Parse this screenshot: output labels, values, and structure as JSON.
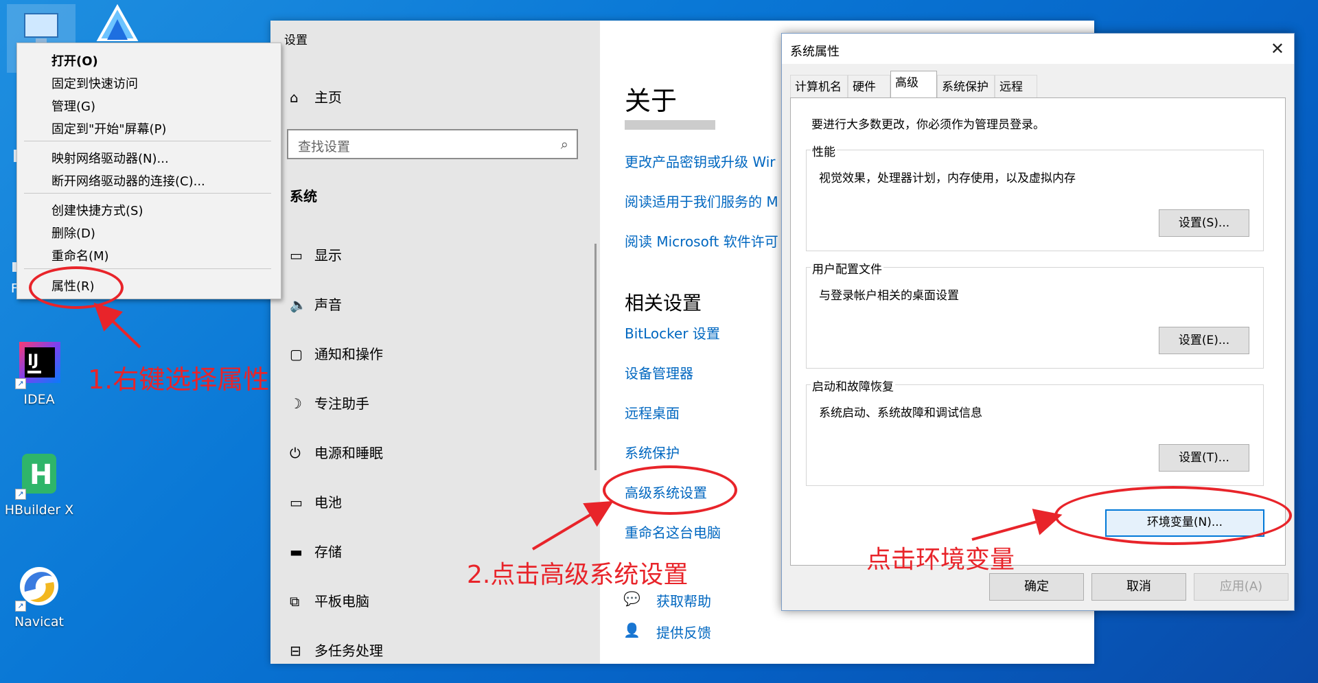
{
  "desktop": {
    "icons": [
      {
        "label": "IDEA",
        "name": "idea-app-icon"
      },
      {
        "label": "HBuilder X",
        "name": "hbuilder-app-icon"
      },
      {
        "label": "Navicat",
        "name": "navicat-app-icon"
      }
    ],
    "partial_letters": [
      "F"
    ]
  },
  "context_menu": {
    "items": [
      "打开(O)",
      "固定到快速访问",
      "管理(G)",
      "固定到\"开始\"屏幕(P)",
      "映射网络驱动器(N)...",
      "断开网络驱动器的连接(C)...",
      "创建快捷方式(S)",
      "删除(D)",
      "重命名(M)",
      "属性(R)"
    ]
  },
  "settings": {
    "title": "设置",
    "home": "主页",
    "search_placeholder": "查找设置",
    "section": "系统",
    "nav": [
      "显示",
      "声音",
      "通知和操作",
      "专注助手",
      "电源和睡眠",
      "电池",
      "存储",
      "平板电脑",
      "多任务处理"
    ],
    "about_title": "关于",
    "links_top": [
      "更改产品密钥或升级 Wir",
      "阅读适用于我们服务的 M",
      "阅读 Microsoft 软件许可条"
    ],
    "related_title": "相关设置",
    "related_links": [
      "BitLocker 设置",
      "设备管理器",
      "远程桌面",
      "系统保护",
      "高级系统设置",
      "重命名这台电脑"
    ],
    "help": "获取帮助",
    "feedback": "提供反馈"
  },
  "sysprops": {
    "title": "系统属性",
    "tabs": [
      "计算机名",
      "硬件",
      "高级",
      "系统保护",
      "远程"
    ],
    "note": "要进行大多数更改，你必须作为管理员登录。",
    "perf": {
      "title": "性能",
      "desc": "视觉效果，处理器计划，内存使用，以及虚拟内存",
      "button": "设置(S)..."
    },
    "profile": {
      "title": "用户配置文件",
      "desc": "与登录帐户相关的桌面设置",
      "button": "设置(E)..."
    },
    "startup": {
      "title": "启动和故障恢复",
      "desc": "系统启动、系统故障和调试信息",
      "button": "设置(T)..."
    },
    "env_button": "环境变量(N)...",
    "ok": "确定",
    "cancel": "取消",
    "apply": "应用(A)"
  },
  "annotations": {
    "step1": "1.右键选择属性",
    "step2": "2.点击高级系统设置",
    "step3": "点击环境变量",
    "color": "#e8242a"
  }
}
